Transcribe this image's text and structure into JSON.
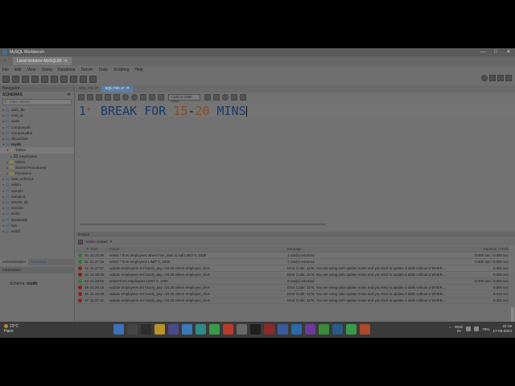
{
  "window": {
    "title": "MySQL Workbench",
    "controls": [
      "—",
      "□",
      "✕"
    ]
  },
  "connection_tab": {
    "label": "Local instance MySQL80",
    "close": "✕"
  },
  "menu": [
    "File",
    "Edit",
    "View",
    "Query",
    "Database",
    "Server",
    "Tools",
    "Scripting",
    "Help"
  ],
  "sidebar": {
    "navigator_label": "Navigator",
    "schemas_label": "SCHEMAS",
    "filter_placeholder": "Filter objects",
    "tree": [
      {
        "label": "auth_db",
        "kind": "db",
        "expanded": false
      },
      {
        "label": "cms_ai",
        "kind": "db",
        "expanded": false
      },
      {
        "label": "class",
        "kind": "db",
        "expanded": false
      },
      {
        "label": "companydb",
        "kind": "db",
        "expanded": false
      },
      {
        "label": "companydb2",
        "kind": "db",
        "expanded": false
      },
      {
        "label": "dbcarslive",
        "kind": "db",
        "expanded": false
      },
      {
        "label": "mydb",
        "kind": "db",
        "expanded": true,
        "bold": true
      },
      {
        "label": "Tables",
        "kind": "folder",
        "expanded": true,
        "indent": 1
      },
      {
        "label": "employees",
        "kind": "table",
        "expanded": false,
        "indent": 2
      },
      {
        "label": "Views",
        "kind": "folder",
        "expanded": false,
        "indent": 1
      },
      {
        "label": "Stored Procedures",
        "kind": "folder",
        "expanded": false,
        "indent": 1
      },
      {
        "label": "Functions",
        "kind": "folder",
        "expanded": false,
        "indent": 1
      },
      {
        "label": "new_schema",
        "kind": "db",
        "expanded": false
      },
      {
        "label": "sakila",
        "kind": "db",
        "expanded": false
      },
      {
        "label": "sample",
        "kind": "db",
        "expanded": false
      },
      {
        "label": "sample2",
        "kind": "db",
        "expanded": false
      },
      {
        "label": "sanskt_db",
        "kind": "db",
        "expanded": false
      },
      {
        "label": "sanskrt",
        "kind": "db",
        "expanded": false
      },
      {
        "label": "sisha",
        "kind": "db",
        "expanded": false
      },
      {
        "label": "studentdb",
        "kind": "db",
        "expanded": false
      },
      {
        "label": "sys",
        "kind": "db",
        "expanded": false
      },
      {
        "label": "world",
        "kind": "db",
        "expanded": false
      }
    ],
    "bottom_tabs": [
      "Administration",
      "Schemas"
    ],
    "info_label": "Information",
    "schema_info_label": "Schema:",
    "schema_info_value": "mydb"
  },
  "editor": {
    "tabs": [
      {
        "label": "SQL File 3*",
        "active": false
      },
      {
        "label": "SQL File 4*",
        "active": true
      }
    ],
    "limit_label": "Limit to 1000 rows",
    "line_number": "1",
    "code_tokens": [
      {
        "text": "BREAK ",
        "type": "kw"
      },
      {
        "text": "FOR ",
        "type": "kw"
      },
      {
        "text": "15",
        "type": "num"
      },
      {
        "text": "-",
        "type": "plain"
      },
      {
        "text": "20 ",
        "type": "num"
      },
      {
        "text": "MINS",
        "type": "kw"
      }
    ]
  },
  "output": {
    "panel_label": "Output",
    "dropdown_label": "Action Output",
    "columns": {
      "num": "#",
      "time": "Time",
      "action": "Action",
      "message": "Message",
      "duration": "Duration / Fetch"
    },
    "rows": [
      {
        "status": "ok",
        "num": "40",
        "time": "21:24:35",
        "action": "select * from employees where hire_date is null LIMIT 0, 1000",
        "message": "1 row(s) returned",
        "duration": "0.000 sec / 0.000 sec"
      },
      {
        "status": "ok",
        "num": "41",
        "time": "21:27:18",
        "action": "select * from employees LIMIT 0, 1000",
        "message": "7 row(s) returned",
        "duration": "0.000 sec / 0.000 sec"
      },
      {
        "status": "err",
        "num": "42",
        "time": "21:27:57",
        "action": "update employees  set hourly_pay =10.25 where employee_id=6",
        "message": "Error Code: 1175. You are using safe update mode and you tried to update a table without a WHER...",
        "duration": "0.000 sec"
      },
      {
        "status": "err",
        "num": "43",
        "time": "21:28:30",
        "action": "update employees  set hourly_pay =10.25 where employee_id=6",
        "message": "Error Code: 1175. You are using safe update mode and you tried to update a table without a WHER...",
        "duration": "0.000 sec"
      },
      {
        "status": "ok",
        "num": "44",
        "time": "21:28:58",
        "action": "select*from employees LIMIT 0, 1000",
        "message": "6 row(s) returned",
        "duration": "0.000 sec / 0.000 sec"
      },
      {
        "status": "err",
        "num": "45",
        "time": "21:34:18",
        "action": "update employees  set hourly_pay =10.25 where employee_id=6",
        "message": "Error Code: 1175. You are using safe update mode and you tried to update a table without a WHER...",
        "duration": "0.000 sec"
      },
      {
        "status": "err",
        "num": "46",
        "time": "21:34:29",
        "action": "update employees  set hourly_pay =10.25 where employee_id=6",
        "message": "Error Code: 1175. You are using safe update mode and you tried to update a table without a WHER...",
        "duration": "0.016 sec"
      },
      {
        "status": "err",
        "num": "47",
        "time": "21:37:21",
        "action": "update employees  set hourly_pay =10.25 where employee_id=6",
        "message": "Error Code: 1175. You are using safe update mode and you tried to update a table without a WHER...",
        "duration": "0.000 sec"
      }
    ]
  },
  "taskbar": {
    "weather_temp": "29°C",
    "weather_desc": "Haze",
    "lang_top": "ENG",
    "lang_bottom": "IN",
    "battery": "76%",
    "time": "22:16",
    "date": "17-09-2024",
    "app_colors": [
      "#3a73b8",
      "#454545",
      "#2d2d2d",
      "#b8922a",
      "#4a4a8a",
      "#3a7ab8",
      "#2f8a8a",
      "#3a9a4a",
      "#b83a2a",
      "#6a6a6a",
      "#1f1f1f",
      "#8a2a2a",
      "#3a5a9a",
      "#2a6aa8",
      "#6a3a9a",
      "#3a8a3a",
      "#2a5a8a",
      "#3a9a4a",
      "#aa4a2a"
    ]
  }
}
